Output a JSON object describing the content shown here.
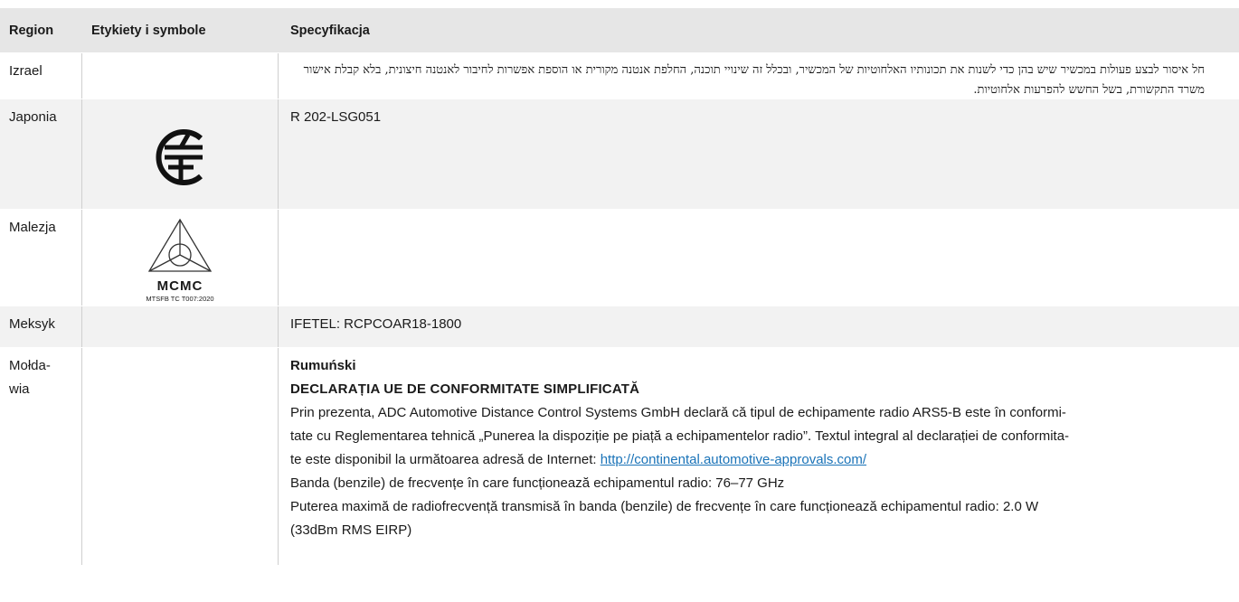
{
  "table": {
    "headers": {
      "region": "Region",
      "labels": "Etykiety i symbole",
      "spec": "Specyfikacja"
    },
    "rows": [
      {
        "region": "Izrael",
        "spec": "חל איסור לבצע פעולות במכשיר שיש בהן כדי לשנות את תכונותיו האלחוטיות של המכשיר, ובכלל זה שינויי תוכנה, החלפת אנטנה מקורית או הוספת אפשרות לחיבור לאנטנה חיצונית, בלא קבלת אישור משרד התקשורת, בשל החשש להפרעות אלחוטיות."
      },
      {
        "region": "Japonia",
        "symbol": "japan-telec-mark-icon",
        "spec": "R 202-LSG051"
      },
      {
        "region": "Malezja",
        "symbol": "mcmc-mark-icon",
        "symbol_text": "MCMC",
        "symbol_caption": "MTSFB TC T007:2020",
        "spec": ""
      },
      {
        "region": "Meksyk",
        "spec": "IFETEL: RCPCOAR18-1800"
      },
      {
        "region_line1": "Mołda-",
        "region_line2": "wia",
        "language": "Rumuński",
        "declaration_title": "DECLARAȚIA UE DE CONFORMITATE SIMPLIFICATĂ",
        "p1_line1": "Prin prezenta, ADC Automotive Distance Control Systems GmbH declară că tipul de echipamente radio ARS5-B este în conformi-",
        "p1_line2": "tate cu Reglementarea tehnică „Punerea la dispoziție pe piață a echipamentelor radio”. Textul integral al declarației de conformita-",
        "p1_line3_prefix": "te este disponibil la următoarea adresă de Internet: ",
        "url": "http://continental.automotive-approvals.com/",
        "band": "Banda (benzile) de frecvențe în care funcționează echipamentul radio: 76–77 GHz",
        "power_line1": "Puterea maximă de radiofrecvență transmisă în banda (benzile) de frecvențe în care funcționează echipamentul radio: 2.0 W",
        "power_line2": "(33dBm RMS EIRP)"
      }
    ]
  }
}
